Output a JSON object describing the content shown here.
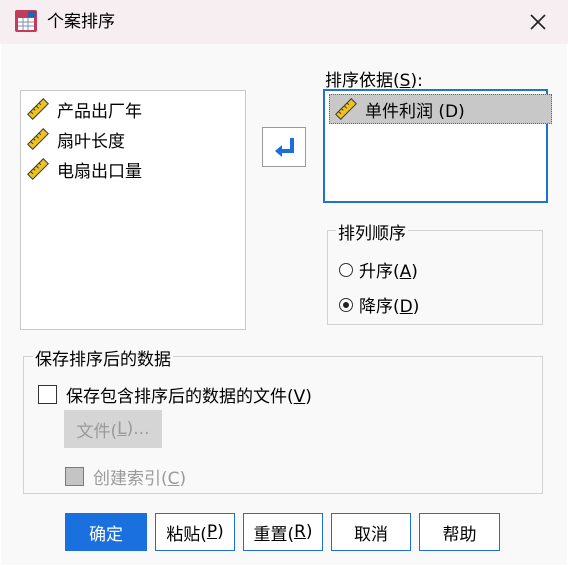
{
  "window": {
    "title": "个案排序",
    "app_icon": "spss-data-icon",
    "close_icon": "close-icon"
  },
  "variables": {
    "items": [
      {
        "label": "产品出厂年",
        "icon": "ruler-scale-icon"
      },
      {
        "label": "扇叶长度",
        "icon": "ruler-scale-icon"
      },
      {
        "label": "电扇出口量",
        "icon": "ruler-scale-icon"
      }
    ]
  },
  "move_button": {
    "icon": "arrow-left-icon",
    "arrow_color": "#1b6fd8"
  },
  "sort_by": {
    "label_prefix": "排序依据(",
    "label_key": "S",
    "label_suffix": "):",
    "items": [
      {
        "label": "单件利润 (D)",
        "icon": "ruler-scale-icon"
      }
    ],
    "border_color": "#1e73d2"
  },
  "sort_order": {
    "title": "排列顺序",
    "options": [
      {
        "prefix": "升序(",
        "key": "A",
        "suffix": ")",
        "selected": false
      },
      {
        "prefix": "降序(",
        "key": "D",
        "suffix": ")",
        "selected": true
      }
    ]
  },
  "save": {
    "title": "保存排序后的数据",
    "checkbox": {
      "prefix": "保存包含排序后的数据的文件(",
      "key": "V",
      "suffix": ")",
      "checked": false
    },
    "file_button": {
      "prefix": "文件(",
      "key": "L",
      "suffix": ")..."
    },
    "index_checkbox": {
      "prefix": "创建索引(",
      "key": "C",
      "suffix": ")",
      "checked": false,
      "disabled": true
    }
  },
  "buttons": [
    {
      "prefix": "确定",
      "key": "",
      "suffix": ""
    },
    {
      "prefix": "粘贴(",
      "key": "P",
      "suffix": ")"
    },
    {
      "prefix": "重置(",
      "key": "R",
      "suffix": ")"
    },
    {
      "prefix": "取消",
      "key": "",
      "suffix": ""
    },
    {
      "prefix": "帮助",
      "key": "",
      "suffix": ""
    }
  ],
  "colors": {
    "accent": "#1b70e0",
    "titlebar": "#f6eef0",
    "ruler_yellow": "#f2c21b"
  }
}
